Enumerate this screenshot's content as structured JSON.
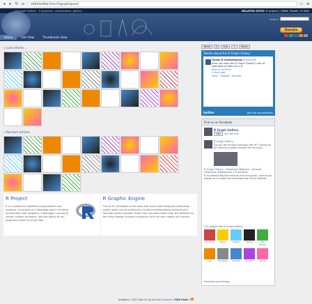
{
  "browser": {
    "url": "addictedtor.free.fr/graphiques/"
  },
  "header": {
    "tagline": "R Graph Gallery - R graphics, visualization, gallery",
    "related_label": "RELATED SITES:",
    "related_links": "R project | CRAN | Rseek | R Wiki",
    "search_label": "search",
    "nav": [
      "Home",
      "List View",
      "Thumbnails View"
    ],
    "donate": "Donate"
  },
  "main": {
    "last_articles": "» Last articles ...",
    "random_articles": "» Random articles",
    "last_count": 29,
    "random_count": 22
  },
  "features": [
    {
      "title": "R Project",
      "text": "R is a system for statistical computation and graphics. It consists of a language plus a run-time environment with graphics, a debugger, access to certain system functions, and the ability to run programs stored in script files."
    },
    {
      "title": "R Graphic Engine",
      "text": "One of R's strengths is the ease with which well-designed publication-quality plots can be produced, including mathematical symbols and formulae where needed. Great care has been taken over the defaults for the minor design choices in graphics, but the user retains full control."
    }
  ],
  "sidebar": {
    "share": [
      "Tweet",
      "0",
      "Like",
      "7",
      "Share"
    ],
    "twitter": {
      "title": "Tweets about the R Graph Gallery",
      "user": "Tomás R @datostomas",
      "reply_to": "@sosevett",
      "text": "have you seen the R Graph Gallery? Lots of examples of data viz in R",
      "link": "http://t.co/XXGP",
      "time": "4 days ago",
      "actions": "reply · retweet · favorite",
      "brand": "twitter",
      "join": "Join the conversation"
    },
    "facebook": {
      "title": "Find us on Facebook",
      "page": "R Graph Gallery",
      "like": "Like",
      "likes": "You like this.",
      "post_author": "R Graph Gallery",
      "post_text": "Do you like simple manually well R? Coming to be used as a graph tutorial for the blog...",
      "post_link": "R Graph Gallery - Download Webcam - Amazon Financials, Professional & Education",
      "post_desc": "R as without Bayfile extracts into the graph, used to be shown as included the development of the website.",
      "people": "131 people like R Graph Gallery.",
      "fans": [
        "Ant Rmg",
        "Farah",
        "Daniel",
        "Tomas",
        "Alex Moore",
        "Lee",
        "Christine",
        "Brenda",
        "Richard",
        "Nicole"
      ],
      "plugin": "Facebook social plugin"
    }
  },
  "footer": {
    "updated": "Updated » 2011 Nov 22 by",
    "author": "Romain François",
    "rss": "» RSS Feed »"
  }
}
